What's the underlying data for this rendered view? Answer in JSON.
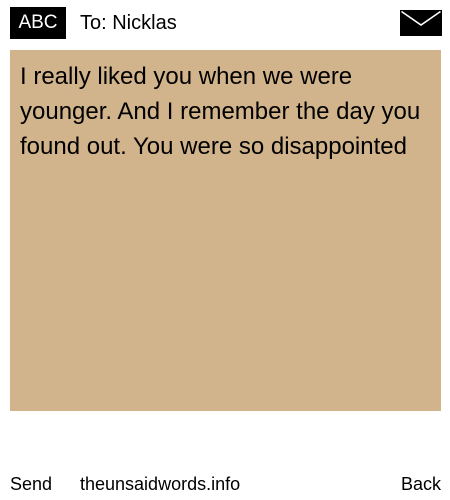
{
  "header": {
    "input_mode_label": "ABC",
    "recipient": "To: Nicklas",
    "message_icon": "envelope-icon"
  },
  "message": {
    "body": "I really liked you when we were younger. And I remember the day you found out. You were so disappointed",
    "background_color": "#d2b48c"
  },
  "footer": {
    "send_label": "Send",
    "site": "theunsaidwords.info",
    "back_label": "Back"
  }
}
